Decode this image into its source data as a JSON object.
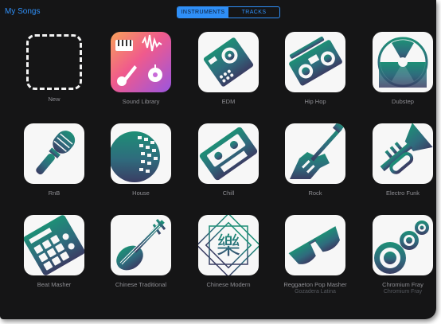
{
  "header": {
    "back_label": "My Songs",
    "segments": [
      {
        "label": "INSTRUMENTS",
        "active": true
      },
      {
        "label": "TRACKS",
        "active": false
      }
    ]
  },
  "colors": {
    "accent": "#2f8ff7",
    "background": "#151516",
    "label": "#8e8e93",
    "gradient_top": "#1d8f76",
    "gradient_mid": "#2f6b7d",
    "gradient_bottom": "#3a3d63"
  },
  "tiles": [
    {
      "label": "New",
      "icon": "dashed-plus-icon"
    },
    {
      "label": "Sound Library",
      "icon": "sound-library-icon"
    },
    {
      "label": "EDM",
      "icon": "drum-machine-icon"
    },
    {
      "label": "Hip Hop",
      "icon": "boombox-icon"
    },
    {
      "label": "Dubstep",
      "icon": "radiation-icon"
    },
    {
      "label": "RnB",
      "icon": "microphone-icon"
    },
    {
      "label": "House",
      "icon": "disco-ball-icon"
    },
    {
      "label": "Chill",
      "icon": "cassette-icon"
    },
    {
      "label": "Rock",
      "icon": "electric-guitar-icon"
    },
    {
      "label": "Electro Funk",
      "icon": "trumpet-icon"
    },
    {
      "label": "Beat Masher",
      "icon": "beat-pad-icon"
    },
    {
      "label": "Chinese Traditional",
      "icon": "pipa-icon"
    },
    {
      "label": "Chinese Modern",
      "icon": "yue-character-icon",
      "glyph": "樂"
    },
    {
      "label": "Reggaeton Pop Masher",
      "sublabel": "Gozadera Latina",
      "icon": "sunglasses-icon"
    },
    {
      "label": "Chromium Fray",
      "sublabel": "Chromium Fray",
      "icon": "speaker-rings-icon"
    }
  ]
}
